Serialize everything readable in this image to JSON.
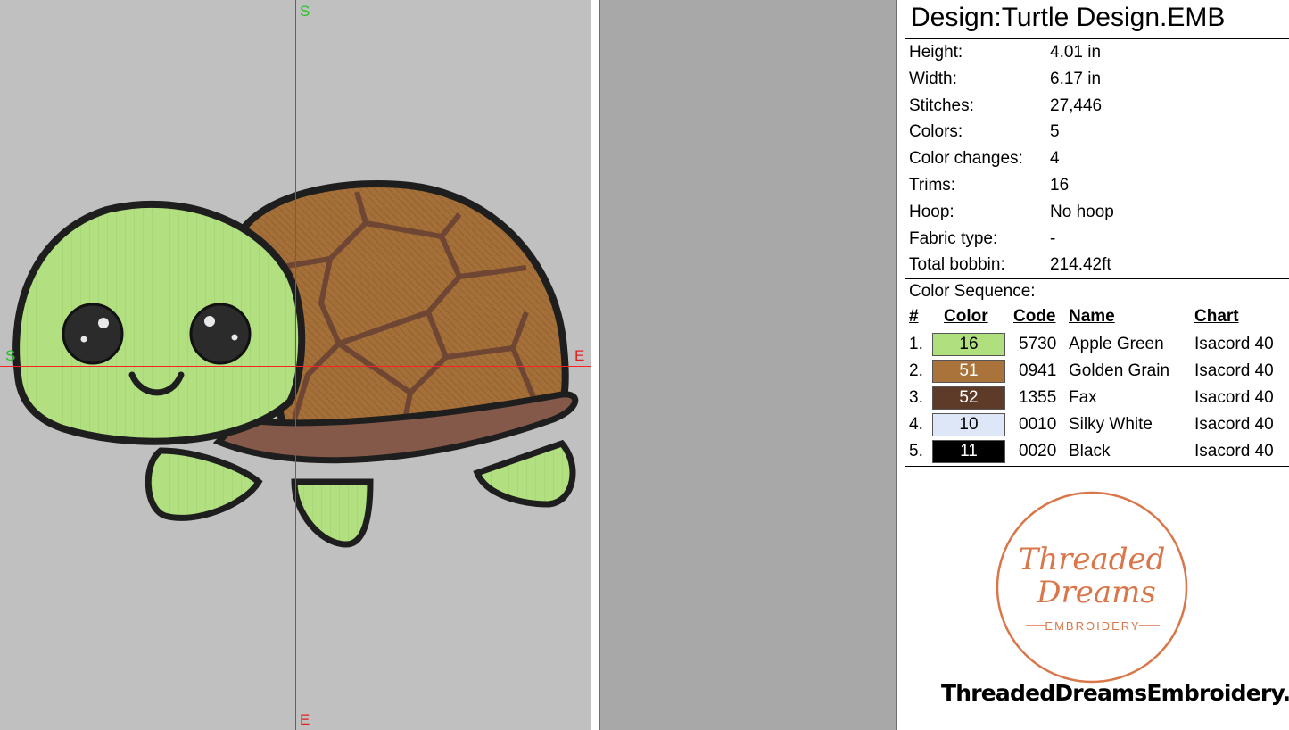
{
  "design": {
    "title": "Design:Turtle Design.EMB"
  },
  "info": [
    {
      "label": "Height:",
      "value": "4.01 in"
    },
    {
      "label": "Width:",
      "value": "6.17 in"
    },
    {
      "label": "Stitches:",
      "value": "27,446"
    },
    {
      "label": "Colors:",
      "value": "5"
    },
    {
      "label": "Color changes:",
      "value": "4"
    },
    {
      "label": "Trims:",
      "value": "16"
    },
    {
      "label": "Hoop:",
      "value": "No hoop"
    },
    {
      "label": "Fabric type:",
      "value": "-"
    },
    {
      "label": "Total bobbin:",
      "value": "214.42ft"
    }
  ],
  "sequence": {
    "title": "Color Sequence:",
    "headers": {
      "num": "#",
      "color": "Color",
      "code": "Code",
      "name": "Name",
      "chart": "Chart"
    },
    "rows": [
      {
        "num": "1.",
        "swatch": "16",
        "swatch_color": "#b0e07e",
        "text_color": "#000000",
        "code": "5730",
        "name": "Apple Green",
        "chart": "Isacord 40"
      },
      {
        "num": "2.",
        "swatch": "51",
        "swatch_color": "#a9733b",
        "text_color": "#ffffff",
        "code": "0941",
        "name": "Golden Grain",
        "chart": "Isacord 40"
      },
      {
        "num": "3.",
        "swatch": "52",
        "swatch_color": "#5e3b28",
        "text_color": "#ffffff",
        "code": "1355",
        "name": "Fax",
        "chart": "Isacord 40"
      },
      {
        "num": "4.",
        "swatch": "10",
        "swatch_color": "#dde7f7",
        "text_color": "#000000",
        "code": "0010",
        "name": "Silky White",
        "chart": "Isacord 40"
      },
      {
        "num": "5.",
        "swatch": "11",
        "swatch_color": "#000000",
        "text_color": "#ffffff",
        "code": "0020",
        "name": "Black",
        "chart": "Isacord 40"
      }
    ]
  },
  "canvas": {
    "marks": {
      "start_top": "S",
      "start_left": "S",
      "end_right": "E",
      "end_bottom": "E"
    },
    "colors": {
      "background": "#c0c0c0",
      "crosshair": "#ff2020",
      "start_mark": "#22c422",
      "end_mark": "#e02020"
    }
  },
  "logo": {
    "line1": "Threaded",
    "line2": "Dreams",
    "line3": "EMBROIDERY",
    "color": "#d9764a"
  },
  "website": "ThreadedDreamsEmbroidery.ca"
}
